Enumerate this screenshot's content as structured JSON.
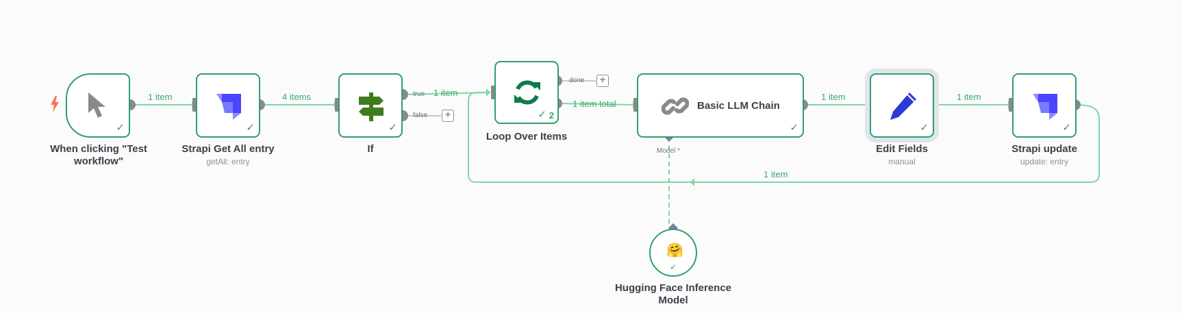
{
  "colors": {
    "node_border": "#2f9e6b",
    "edge": "#7fd6a6",
    "edge_label": "#3aa66f",
    "port": "#8a8a8a",
    "trigger_bolt": "#ff6d5a",
    "strapi_brand": "#4945ff",
    "if_icon": "#3f7c1f",
    "loop_icon": "#0f7a4a",
    "edit_icon": "#2d3bd6",
    "llm_icon": "#8a8a8a"
  },
  "nodes": {
    "manual_trigger": {
      "title": "When clicking \"Test workflow\"",
      "icon": "cursor-arrow-icon"
    },
    "strapi_get": {
      "title": "Strapi Get All entry",
      "subtitle": "getAll: entry",
      "icon": "strapi-icon"
    },
    "if": {
      "title": "If",
      "icon": "signpost-icon",
      "outputs": [
        "true",
        "false"
      ]
    },
    "loop": {
      "title": "Loop Over Items",
      "icon": "refresh-icon",
      "outputs": [
        "done"
      ],
      "run_count": "2"
    },
    "llm_chain": {
      "title": "Basic LLM Chain",
      "icon": "chain-link-icon",
      "model_port": "Model",
      "required_mark": "*"
    },
    "edit_fields": {
      "title": "Edit Fields",
      "subtitle": "manual",
      "icon": "pencil-icon"
    },
    "strapi_update": {
      "title": "Strapi update",
      "subtitle": "update: entry",
      "icon": "strapi-icon"
    },
    "hugging_face": {
      "title": "Hugging Face Inference Model",
      "icon": "hugging-face-emoji",
      "emoji": "🤗"
    }
  },
  "edges": {
    "trigger_to_get": "1 item",
    "get_to_if": "4 items",
    "if_true_to_loop": "1 item",
    "loop_to_llm": "1 item total",
    "llm_to_edit": "1 item",
    "edit_to_update": "1 item",
    "update_back_to_loop": "1 item"
  },
  "add_button_glyph": "+",
  "check_glyph": "✓"
}
